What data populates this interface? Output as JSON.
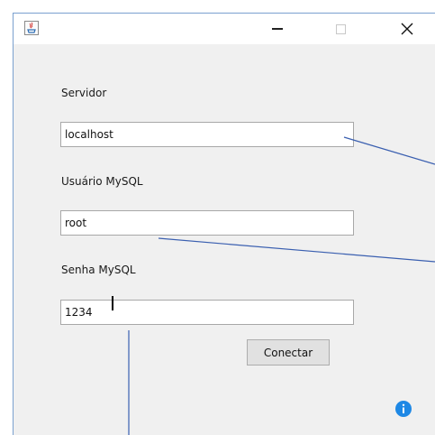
{
  "window": {
    "title_icon": "java-app-icon",
    "controls": {
      "minimize_icon": "minimize-icon",
      "maximize_icon": "maximize-icon",
      "close_icon": "close-icon"
    }
  },
  "form": {
    "servidor_label": "Servidor",
    "servidor_value": "localhost",
    "usuario_label": "Usuário MySQL",
    "usuario_value": "root",
    "senha_label": "Senha MySQL",
    "senha_value": "1234",
    "connect_label": "Conectar"
  },
  "icons": {
    "info": "info-icon"
  },
  "colors": {
    "window_border": "#7aa0cf",
    "window_bg": "#f0f0f0",
    "annotation_line": "#3a5fb0",
    "info_blue": "#1e88e5"
  }
}
